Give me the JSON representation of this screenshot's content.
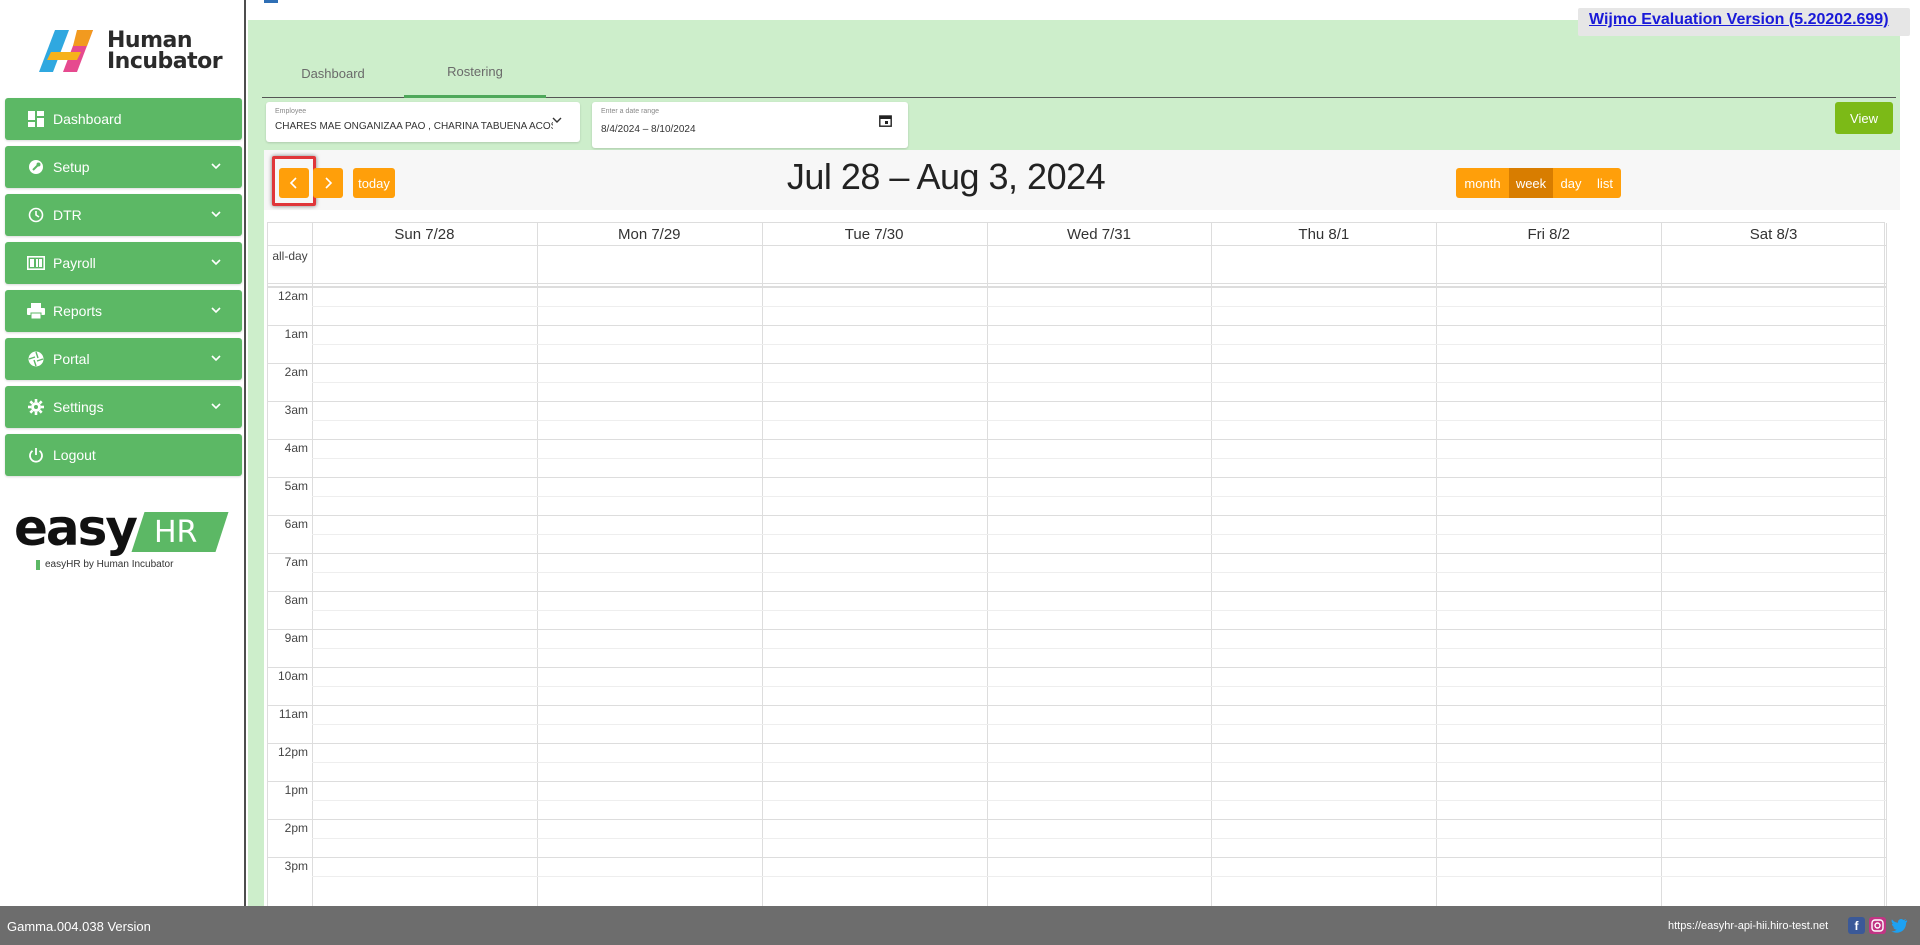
{
  "brand": {
    "logo_text_line1": "Human",
    "logo_text_line2": "Incubator"
  },
  "sidebar": {
    "items": [
      {
        "label": "Dashboard",
        "icon": "dashboard-icon",
        "has_chevron": false
      },
      {
        "label": "Setup",
        "icon": "wrench-icon",
        "has_chevron": true
      },
      {
        "label": "DTR",
        "icon": "clock-icon",
        "has_chevron": true
      },
      {
        "label": "Payroll",
        "icon": "payroll-icon",
        "has_chevron": true
      },
      {
        "label": "Reports",
        "icon": "printer-icon",
        "has_chevron": true
      },
      {
        "label": "Portal",
        "icon": "aperture-icon",
        "has_chevron": true
      },
      {
        "label": "Settings",
        "icon": "gear-icon",
        "has_chevron": true
      },
      {
        "label": "Logout",
        "icon": "power-icon",
        "has_chevron": false
      }
    ],
    "easyhr": {
      "word": "easy",
      "hr": "HR",
      "tagline": "easyHR by Human Incubator"
    }
  },
  "wijmo": {
    "text": "Wijmo Evaluation Version (5.20202.699)"
  },
  "tabs": [
    {
      "label": "Dashboard",
      "active": false
    },
    {
      "label": "Rostering",
      "active": true
    }
  ],
  "filters": {
    "employee": {
      "label": "Employee",
      "value": "CHARES MAE ONGANIZAA PAO , CHARINA TABUENA ACOSTA"
    },
    "date_range": {
      "label": "Enter a date range",
      "value": "8/4/2024 – 8/10/2024"
    },
    "view_button": "View"
  },
  "calendar": {
    "title": "Jul 28 – Aug 3, 2024",
    "today_label": "today",
    "views": [
      {
        "label": "month",
        "active": false
      },
      {
        "label": "week",
        "active": true
      },
      {
        "label": "day",
        "active": false
      },
      {
        "label": "list",
        "active": false
      }
    ],
    "days": [
      "Sun 7/28",
      "Mon 7/29",
      "Tue 7/30",
      "Wed 7/31",
      "Thu 8/1",
      "Fri 8/2",
      "Sat 8/3"
    ],
    "allday_label": "all-day",
    "times": [
      "12am",
      "1am",
      "2am",
      "3am",
      "4am",
      "5am",
      "6am",
      "7am",
      "8am",
      "9am",
      "10am",
      "11am",
      "12pm",
      "1pm",
      "2pm",
      "3pm"
    ]
  },
  "footer": {
    "version": "Gamma.004.038 Version",
    "url": "https://easyhr-api-hii.hiro-test.net"
  },
  "colors": {
    "accent_green": "#5cb865",
    "calendar_orange": "#ff9f0a",
    "content_bg": "#cdeecb",
    "view_green": "#7cba17"
  }
}
